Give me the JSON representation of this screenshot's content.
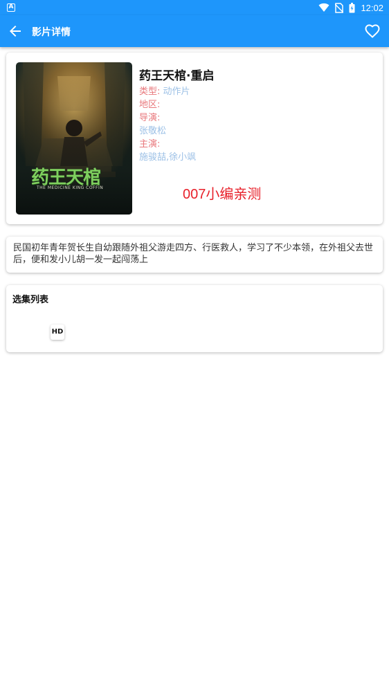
{
  "status_bar": {
    "app_badge": "A",
    "time": "12:02"
  },
  "app_bar": {
    "title": "影片详情"
  },
  "movie": {
    "poster_title": "药王天棺",
    "poster_subtitle": "THE MEDICINE KING COFFIN",
    "title": "药王天棺·重启",
    "type_label": "类型:",
    "type_value": "动作片",
    "region_label": "地区:",
    "region_value": "",
    "director_label": "导演:",
    "director_value": "张敬松",
    "cast_label": "主演:",
    "cast_value": "施骏喆,徐小飒",
    "promo_text": "007小编亲测"
  },
  "synopsis": {
    "text": "民国初年青年贺长生自幼跟随外祖父游走四方、行医救人，学习了不少本领，在外祖父去世后，便和发小儿胡一发一起闯荡上"
  },
  "episodes": {
    "title": "选集列表",
    "items": [
      "HD"
    ]
  },
  "colors": {
    "primary": "#1e96fb",
    "label": "#e8777b",
    "value": "#9cc0e6",
    "promo": "#e8202a"
  }
}
